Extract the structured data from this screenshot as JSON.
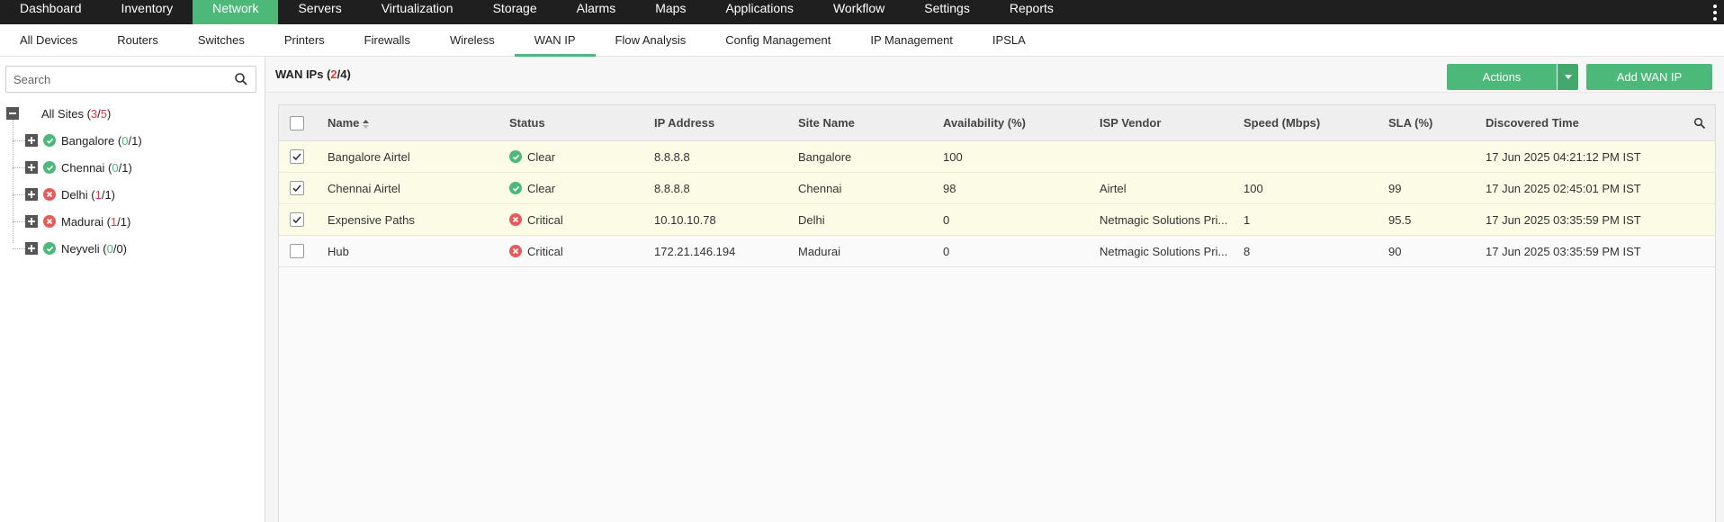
{
  "topnav": {
    "items": [
      "Dashboard",
      "Inventory",
      "Network",
      "Servers",
      "Virtualization",
      "Storage",
      "Alarms",
      "Maps",
      "Applications",
      "Workflow",
      "Settings",
      "Reports"
    ],
    "active": "Network",
    "more_icon": "kebab-icon"
  },
  "subnav": {
    "items": [
      "All Devices",
      "Routers",
      "Switches",
      "Printers",
      "Firewalls",
      "Wireless",
      "WAN IP",
      "Flow Analysis",
      "Config Management",
      "IP Management",
      "IPSLA"
    ],
    "active": "WAN IP"
  },
  "sidebar": {
    "search_placeholder": "Search",
    "root": {
      "label": "All Sites (",
      "down": "3",
      "sep": "/",
      "total": "5",
      "close": ")"
    },
    "sites": [
      {
        "name": "Bangalore",
        "down": "0",
        "total": "1",
        "status": "clear"
      },
      {
        "name": "Chennai",
        "down": "0",
        "total": "1",
        "status": "clear"
      },
      {
        "name": "Delhi",
        "down": "1",
        "total": "1",
        "status": "critical"
      },
      {
        "name": "Madurai",
        "down": "1",
        "total": "1",
        "status": "critical"
      },
      {
        "name": "Neyveli",
        "down": "0",
        "total": "0",
        "status": "clear"
      }
    ]
  },
  "header": {
    "title_prefix": "WAN IPs (",
    "down": "2",
    "sep": "/",
    "total": "4",
    "title_suffix": ")",
    "actions_label": "Actions",
    "add_label": "Add WAN IP"
  },
  "table": {
    "columns": [
      "Name",
      "Status",
      "IP Address",
      "Site Name",
      "Availability (%)",
      "ISP Vendor",
      "Speed (Mbps)",
      "SLA (%)",
      "Discovered Time"
    ],
    "rows": [
      {
        "checked": true,
        "name": "Bangalore Airtel",
        "status": "Clear",
        "ip": "8.8.8.8",
        "site": "Bangalore",
        "availability": "100",
        "isp": "",
        "speed": "",
        "sla": "",
        "discovered": "17 Jun 2025 04:21:12 PM IST"
      },
      {
        "checked": true,
        "name": "Chennai Airtel",
        "status": "Clear",
        "ip": "8.8.8.8",
        "site": "Chennai",
        "availability": "98",
        "isp": "Airtel",
        "speed": "100",
        "sla": "99",
        "discovered": "17 Jun 2025 02:45:01 PM IST"
      },
      {
        "checked": true,
        "name": "Expensive Paths",
        "status": "Critical",
        "ip": "10.10.10.78",
        "site": "Delhi",
        "availability": "0",
        "isp": "Netmagic Solutions Pri...",
        "speed": "1",
        "sla": "95.5",
        "discovered": "17 Jun 2025 03:35:59 PM IST"
      },
      {
        "checked": false,
        "name": "Hub",
        "status": "Critical",
        "ip": "172.21.146.194",
        "site": "Madurai",
        "availability": "0",
        "isp": "Netmagic Solutions Pri...",
        "speed": "8",
        "sla": "90",
        "discovered": "17 Jun 2025 03:35:59 PM IST"
      }
    ]
  },
  "colors": {
    "accent": "#4cb87a",
    "critical": "#e65a5a",
    "link": "#b5a04a",
    "down_count": "#e03c3c"
  }
}
